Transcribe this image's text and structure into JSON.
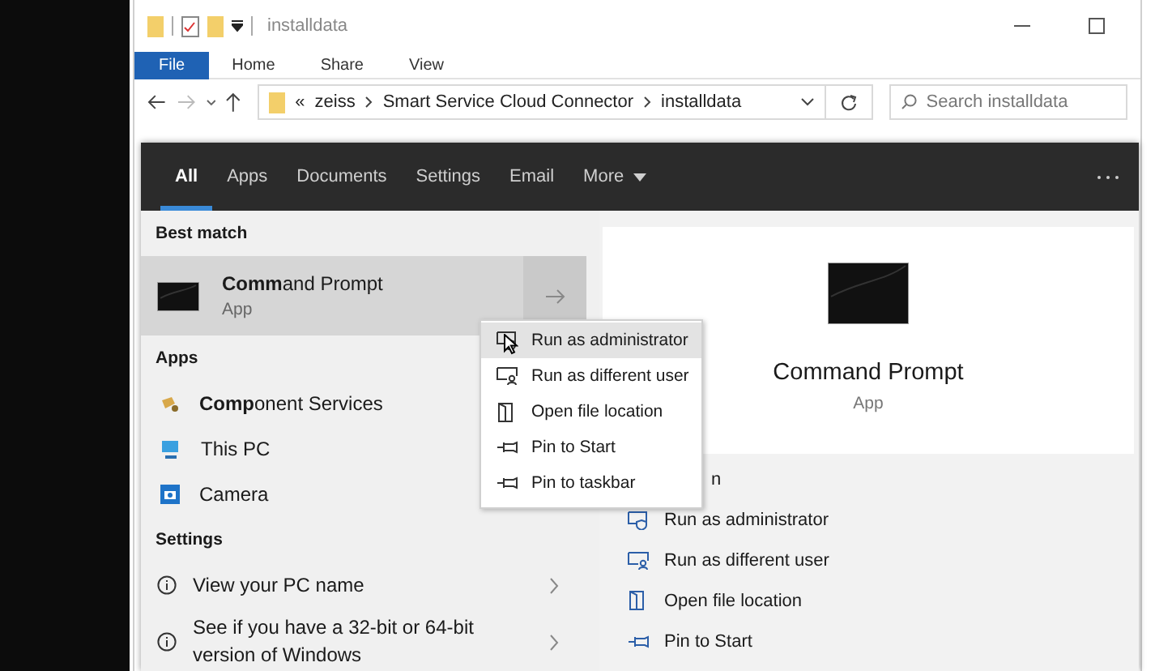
{
  "explorer": {
    "title": "installdata",
    "ribbon_tabs": [
      {
        "label": "File",
        "kind": "file"
      },
      {
        "label": "Home",
        "kind": "tab"
      },
      {
        "label": "Share",
        "kind": "tab"
      },
      {
        "label": "View",
        "kind": "tab"
      }
    ],
    "address": {
      "overflow": "«",
      "path": [
        "zeiss",
        "Smart Service Cloud Connector",
        "installdata"
      ]
    },
    "search": {
      "placeholder": "Search installdata"
    }
  },
  "search_panel": {
    "tabs": [
      {
        "label": "All",
        "selected": true
      },
      {
        "label": "Apps",
        "selected": false
      },
      {
        "label": "Documents",
        "selected": false
      },
      {
        "label": "Settings",
        "selected": false
      },
      {
        "label": "Email",
        "selected": false
      },
      {
        "label": "More",
        "selected": false
      }
    ],
    "best_match": {
      "heading": "Best match",
      "name": "**Comm**and Prompt",
      "type": "App"
    },
    "apps": {
      "heading": "Apps",
      "items": [
        {
          "name": "**Comp**onent Services",
          "kind": "component"
        },
        {
          "name": "This PC",
          "kind": "pc"
        },
        {
          "name": "Camera",
          "kind": "camera"
        }
      ]
    },
    "settings": {
      "heading": "Settings",
      "items": [
        {
          "name": "View your PC name"
        },
        {
          "name": "See if you have a 32-bit or 64-bit version of Windows"
        }
      ]
    },
    "preview": {
      "name": "Command Prompt",
      "type": "App",
      "actions": [
        {
          "label": "n",
          "kind": "partial"
        },
        {
          "label": "Run as administrator",
          "kind": "admin"
        },
        {
          "label": "Run as different user",
          "kind": "user"
        },
        {
          "label": "Open file location",
          "kind": "folder"
        },
        {
          "label": "Pin to Start",
          "kind": "pin"
        }
      ]
    },
    "context_menu": {
      "items": [
        {
          "label": "Run as administrator",
          "kind": "admin",
          "selected": true
        },
        {
          "label": "Run as different user",
          "kind": "user",
          "selected": false
        },
        {
          "label": "Open file location",
          "kind": "folder",
          "selected": false
        },
        {
          "label": "Pin to Start",
          "kind": "pin",
          "selected": false
        },
        {
          "label": "Pin to taskbar",
          "kind": "pin",
          "selected": false
        }
      ]
    }
  }
}
